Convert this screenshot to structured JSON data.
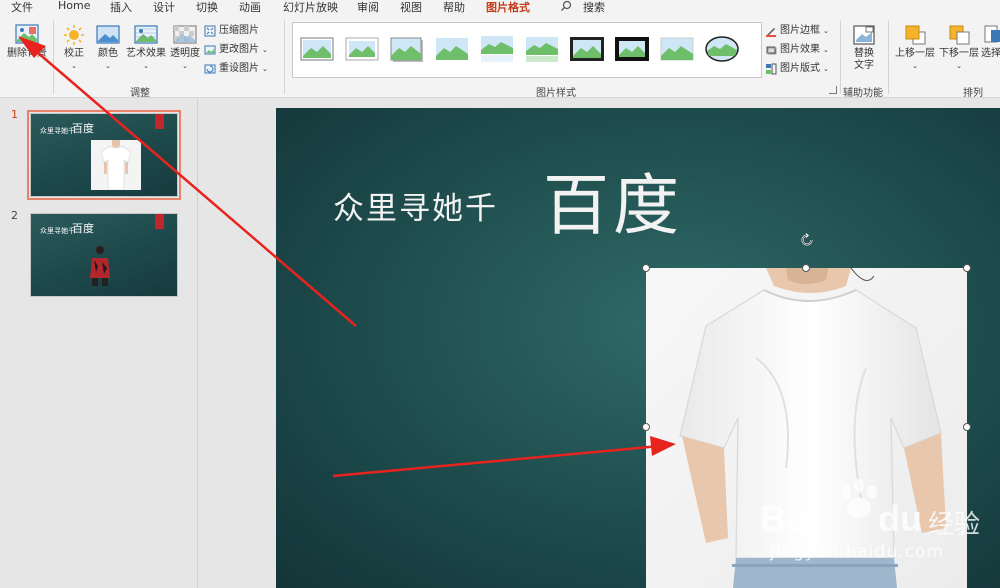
{
  "menu": {
    "tabs": [
      "文件",
      "Home",
      "插入",
      "设计",
      "切换",
      "动画",
      "幻灯片放映",
      "审阅",
      "视图",
      "帮助",
      "图片格式"
    ],
    "active": "图片格式",
    "search": "搜索"
  },
  "ribbon": {
    "remove_bg": "删除背景",
    "correct": "校正",
    "color": "颜色",
    "artistic": "艺术效果",
    "transparency": "透明度",
    "compress": "压缩图片",
    "change": "更改图片",
    "reset": "重设图片",
    "adjust_label": "调整",
    "styles_label": "图片样式",
    "border": "图片边框",
    "effects": "图片效果",
    "layout": "图片版式",
    "alt_text": "替换文字",
    "accessibility_label": "辅助功能",
    "bring_forward": "上移一层",
    "send_backward": "下移一层",
    "selection": "选择",
    "arrange_label": "排列"
  },
  "thumbnails": [
    {
      "num": "1",
      "title_small": "众里寻她千",
      "title_big": "百度"
    },
    {
      "num": "2",
      "title_small": "众里寻她千",
      "title_big": "百度"
    }
  ],
  "slide": {
    "title_small": "众里寻她千",
    "title_big": "百度"
  },
  "watermark": {
    "brand": "Bai",
    "brand2": "du",
    "cn": "经验",
    "url": "jingyan.baidu.com"
  },
  "colors": {
    "accent": "#c43e1c",
    "slide_bg": "#245756",
    "arrow": "#e8231e"
  }
}
